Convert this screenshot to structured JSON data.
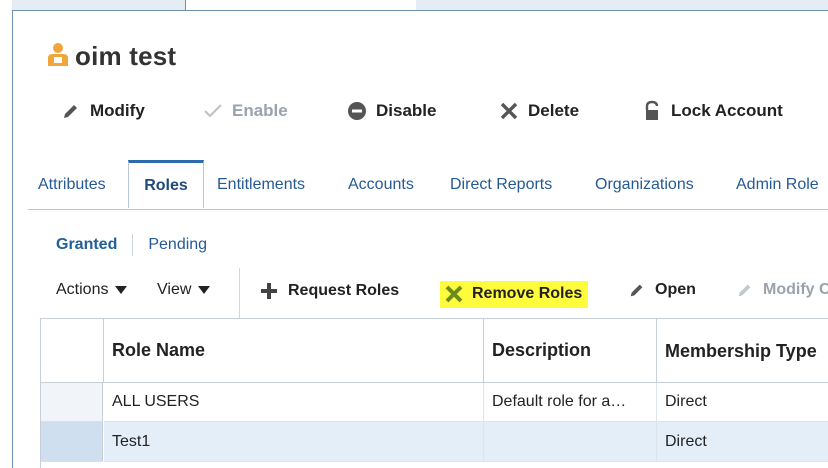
{
  "user": {
    "name": "oim test",
    "icon": "user-icon",
    "icon_color": "#f0a63a"
  },
  "actions": [
    {
      "label": "Modify",
      "icon": "pencil-icon",
      "enabled": true
    },
    {
      "label": "Enable",
      "icon": "checkmark-icon",
      "enabled": false
    },
    {
      "label": "Disable",
      "icon": "minus-circle-icon",
      "enabled": true
    },
    {
      "label": "Delete",
      "icon": "x-icon",
      "enabled": true
    },
    {
      "label": "Lock Account",
      "icon": "lock-icon",
      "enabled": true
    }
  ],
  "tabs": [
    {
      "label": "Attributes",
      "active": false
    },
    {
      "label": "Roles",
      "active": true
    },
    {
      "label": "Entitlements",
      "active": false
    },
    {
      "label": "Accounts",
      "active": false
    },
    {
      "label": "Direct Reports",
      "active": false
    },
    {
      "label": "Organizations",
      "active": false
    },
    {
      "label": "Admin Role",
      "active": false
    }
  ],
  "subtabs": [
    {
      "label": "Granted",
      "active": true
    },
    {
      "label": "Pending",
      "active": false
    }
  ],
  "toolbar": {
    "actions_label": "Actions",
    "view_label": "View",
    "request_roles": "Request Roles",
    "remove_roles": "Remove Roles",
    "open": "Open",
    "modify": "Modify C",
    "highlight_color": "#fffb3d"
  },
  "table": {
    "columns": [
      "Role Name",
      "Description",
      "Membership Type"
    ],
    "rows": [
      {
        "role_name": "ALL USERS",
        "description": "Default role for a…",
        "membership_type": "Direct",
        "selected": false
      },
      {
        "role_name": "Test1",
        "description": "",
        "membership_type": "Direct",
        "selected": true
      }
    ]
  }
}
